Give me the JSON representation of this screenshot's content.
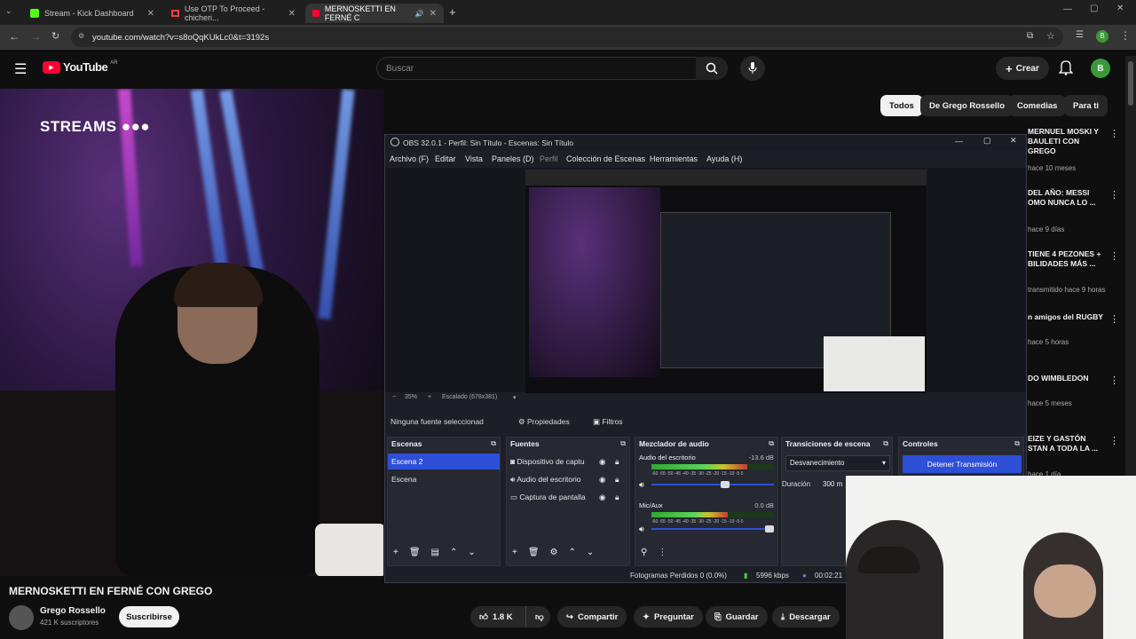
{
  "browser": {
    "tabs": [
      {
        "label": "Stream - Kick Dashboard",
        "icon": "kick-icon"
      },
      {
        "label": "Use OTP To Proceed - chicheri...",
        "icon": "gmail-icon"
      },
      {
        "label": "MERNOSKETTI EN FERNÉ C",
        "icon": "youtube-icon"
      }
    ],
    "url": "youtube.com/watch?v=s8oQqKUkLc0&t=3192s"
  },
  "youtube": {
    "logo": "YouTube",
    "region": "AR",
    "search_placeholder": "Buscar",
    "create_label": "Crear",
    "avatar_letter": "B",
    "chips": [
      "Todos",
      "De Grego Rossello",
      "Comedias",
      "Para ti"
    ],
    "video_logo": "STREAMS",
    "video_title": "MERNOSKETTI EN FERNÉ CON GREGO",
    "channel": "Grego Rossello",
    "subscribers": "421 K suscriptores",
    "subscribe_label": "Suscribirse",
    "likes": "1.8 K",
    "share_label": "Compartir",
    "ask_label": "Preguntar",
    "save_label": "Guardar",
    "download_label": "Descargar",
    "recommendations": [
      {
        "title": "MERNUEL MOSKI Y BAULETI CON GREGO",
        "meta": "hace 10 meses"
      },
      {
        "title": "DEL AÑO: MESSI OMO NUNCA LO ...",
        "meta": "hace 9 días"
      },
      {
        "title": "TIENE 4 PEZONES + BILIDADES MÁS ...",
        "meta": "transmitido hace 9 horas"
      },
      {
        "title": "n amigos del RUGBY",
        "meta": "hace 5 horas"
      },
      {
        "title": "DO WIMBLEDON",
        "meta": "hace 5 meses"
      },
      {
        "title": "EIZE Y GASTÓN STAN A TODA LA ...",
        "meta": "hace 1 día"
      }
    ]
  },
  "obs": {
    "title": "OBS 32.0.1 - Perfil: Sin Título - Escenas: Sin Título",
    "menu": [
      "Archivo (F)",
      "Editar",
      "Vista",
      "Paneles (D)",
      "Perfil",
      "Colección de Escenas",
      "Herramientas",
      "Ayuda (H)"
    ],
    "zoom": "35%",
    "scale": "Escalado (678x381)",
    "no_source": "Ninguna fuente seleccionad",
    "properties_label": "Propiedades",
    "filters_label": "Filtros",
    "scenes_header": "Escenas",
    "scenes": [
      "Escena 2",
      "Escena"
    ],
    "sources_header": "Fuentes",
    "sources": [
      {
        "label": "Dispositivo de captu",
        "icon": "camera-icon"
      },
      {
        "label": "Audio del escritorio",
        "icon": "speaker-icon"
      },
      {
        "label": "Captura de pantalla",
        "icon": "monitor-icon"
      }
    ],
    "mixer_header": "Mezclador de audio",
    "mixer": [
      {
        "name": "Audio del escritorio",
        "db": "-13.6 dB",
        "level": 0.78
      },
      {
        "name": "Mic/Aux",
        "db": "0.0 dB",
        "level": 0.62
      }
    ],
    "meter_scale": "-60 -55 -50 -45 -40 -35 -30 -25 -20 -15 -10 -5 0",
    "transitions_header": "Transiciones de escena",
    "transition": "Desvanecimiento",
    "duration_label": "Duración",
    "duration_value": "300 m",
    "controls_header": "Controles",
    "stop_stream_label": "Detener Transmisión",
    "dropped_frames": "Fotogramas Perdidos 0 (0.0%)",
    "bitrate": "5996 kbps",
    "time": "00:02:21"
  },
  "colors": {
    "obs_selected": "#2e4fd8",
    "yt_red": "#ff0033"
  }
}
